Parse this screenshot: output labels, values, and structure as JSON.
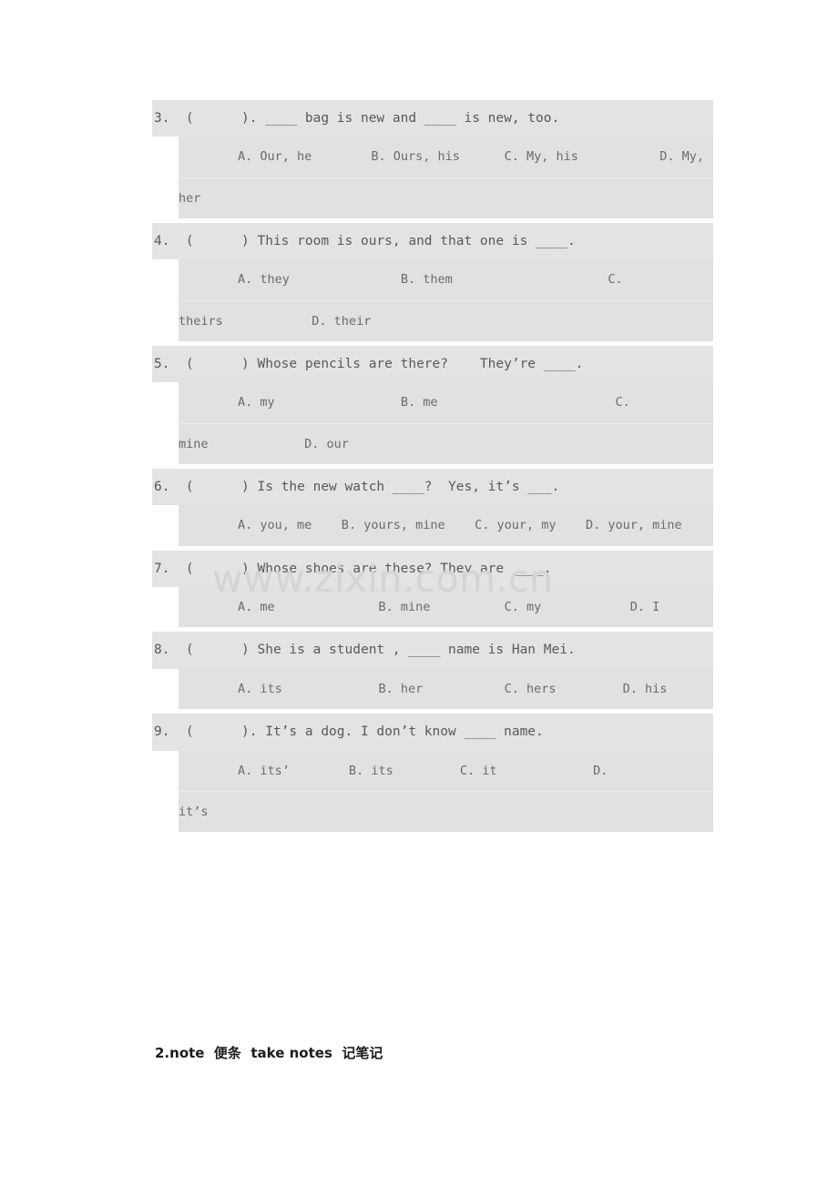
{
  "document": {
    "watermark": "www.zixin.com.cn",
    "trailing_note": "2.note  便条  take notes  记笔记"
  },
  "quiz": {
    "questions": [
      {
        "number": "3.",
        "stem": "3.  (      ). ____ bag is new and ____ is new, too.",
        "choice_lines": [
          "        A. Our, he        B. Ours, his      C. My, his           D. My,",
          "her"
        ]
      },
      {
        "number": "4.",
        "stem": "4.  (      ) This room is ours, and that one is ____.",
        "choice_lines": [
          "        A. they               B. them                     C.",
          "theirs            D. their"
        ]
      },
      {
        "number": "5.",
        "stem": "5.  (      ) Whose pencils are there?    They’re ____.",
        "choice_lines": [
          "        A. my                 B. me                        C.",
          "mine             D. our"
        ]
      },
      {
        "number": "6.",
        "stem": "6.  (      ) Is the new watch ____?  Yes, it’s ___.",
        "choice_lines": [
          "        A. you, me    B. yours, mine    C. your, my    D. your, mine"
        ]
      },
      {
        "number": "7.",
        "stem": "7.  (      ) Whose shoes are these? They are ____.",
        "choice_lines": [
          "        A. me              B. mine          C. my            D. I"
        ]
      },
      {
        "number": "8.",
        "stem": "8.  (      ) She is a student , ____ name is Han Mei.",
        "choice_lines": [
          "        A. its             B. her           C. hers         D. his"
        ]
      },
      {
        "number": "9.",
        "stem": "9.  (      ). It’s a dog. I don’t know ____ name.",
        "choice_lines": [
          "        A. its’        B. its         C. it             D.",
          "it’s"
        ]
      }
    ]
  }
}
